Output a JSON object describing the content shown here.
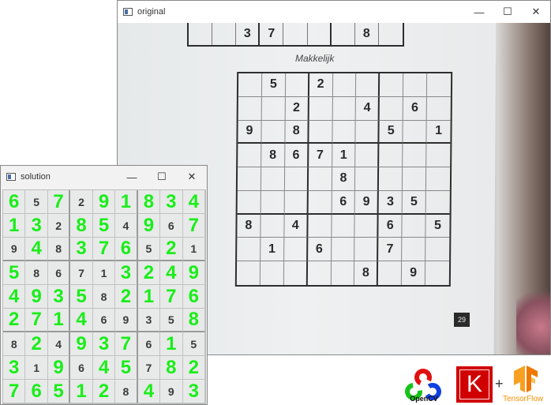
{
  "original_window": {
    "title": "original",
    "controls": {
      "minimize": "—",
      "maximize": "☐",
      "close": "✕"
    },
    "top_strip_cells": [
      "",
      "",
      "3",
      "7",
      "",
      "",
      "",
      "8",
      ""
    ],
    "heading": "Makkelijk",
    "puzzle": [
      [
        "",
        "5",
        "",
        "2",
        "",
        "",
        "",
        "",
        ""
      ],
      [
        "",
        "",
        "2",
        "",
        "",
        "4",
        "",
        "6",
        ""
      ],
      [
        "9",
        "",
        "8",
        "",
        "",
        "",
        "5",
        "",
        "1"
      ],
      [
        "",
        "8",
        "6",
        "7",
        "1",
        "",
        "",
        "",
        ""
      ],
      [
        "",
        "",
        "",
        "",
        "8",
        "",
        "",
        "",
        ""
      ],
      [
        "",
        "",
        "",
        "",
        "6",
        "9",
        "3",
        "5",
        ""
      ],
      [
        "8",
        "",
        "4",
        "",
        "",
        "",
        "6",
        "",
        "5"
      ],
      [
        "",
        "1",
        "",
        "6",
        "",
        "",
        "7",
        "",
        ""
      ],
      [
        "",
        "",
        "",
        "",
        "",
        "8",
        "",
        "9",
        ""
      ]
    ],
    "page_number": "29"
  },
  "solution_window": {
    "title": "solution",
    "controls": {
      "minimize": "—",
      "maximize": "☐",
      "close": "✕"
    },
    "grid": [
      [
        "6",
        "5",
        "7",
        "2",
        "9",
        "1",
        "8",
        "3",
        "4"
      ],
      [
        "1",
        "3",
        "2",
        "8",
        "5",
        "4",
        "9",
        "6",
        "7"
      ],
      [
        "9",
        "4",
        "8",
        "3",
        "7",
        "6",
        "5",
        "2",
        "1"
      ],
      [
        "5",
        "8",
        "6",
        "7",
        "1",
        "3",
        "2",
        "4",
        "9"
      ],
      [
        "4",
        "9",
        "3",
        "5",
        "8",
        "2",
        "1",
        "7",
        "6"
      ],
      [
        "2",
        "7",
        "1",
        "4",
        "6",
        "9",
        "3",
        "5",
        "8"
      ],
      [
        "8",
        "2",
        "4",
        "9",
        "3",
        "7",
        "6",
        "1",
        "5"
      ],
      [
        "3",
        "1",
        "9",
        "6",
        "4",
        "5",
        "7",
        "8",
        "2"
      ],
      [
        "7",
        "6",
        "5",
        "1",
        "2",
        "8",
        "4",
        "9",
        "3"
      ]
    ],
    "given_mask": [
      [
        0,
        1,
        0,
        1,
        0,
        0,
        0,
        0,
        0
      ],
      [
        0,
        0,
        1,
        0,
        0,
        1,
        0,
        1,
        0
      ],
      [
        1,
        0,
        1,
        0,
        0,
        0,
        1,
        0,
        1
      ],
      [
        0,
        1,
        1,
        1,
        1,
        0,
        0,
        0,
        0
      ],
      [
        0,
        0,
        0,
        0,
        1,
        0,
        0,
        0,
        0
      ],
      [
        0,
        0,
        0,
        0,
        1,
        1,
        1,
        1,
        0
      ],
      [
        1,
        0,
        1,
        0,
        0,
        0,
        1,
        0,
        1
      ],
      [
        0,
        1,
        0,
        1,
        0,
        0,
        1,
        0,
        0
      ],
      [
        0,
        0,
        0,
        0,
        0,
        1,
        0,
        1,
        0
      ]
    ],
    "colors": {
      "solved": "#19ee19",
      "given": "#3a3a3a"
    }
  },
  "logos": {
    "opencv_label": "OpenCV",
    "keras_letter": "K",
    "plus": "+",
    "tensorflow_label": "TensorFlow"
  }
}
